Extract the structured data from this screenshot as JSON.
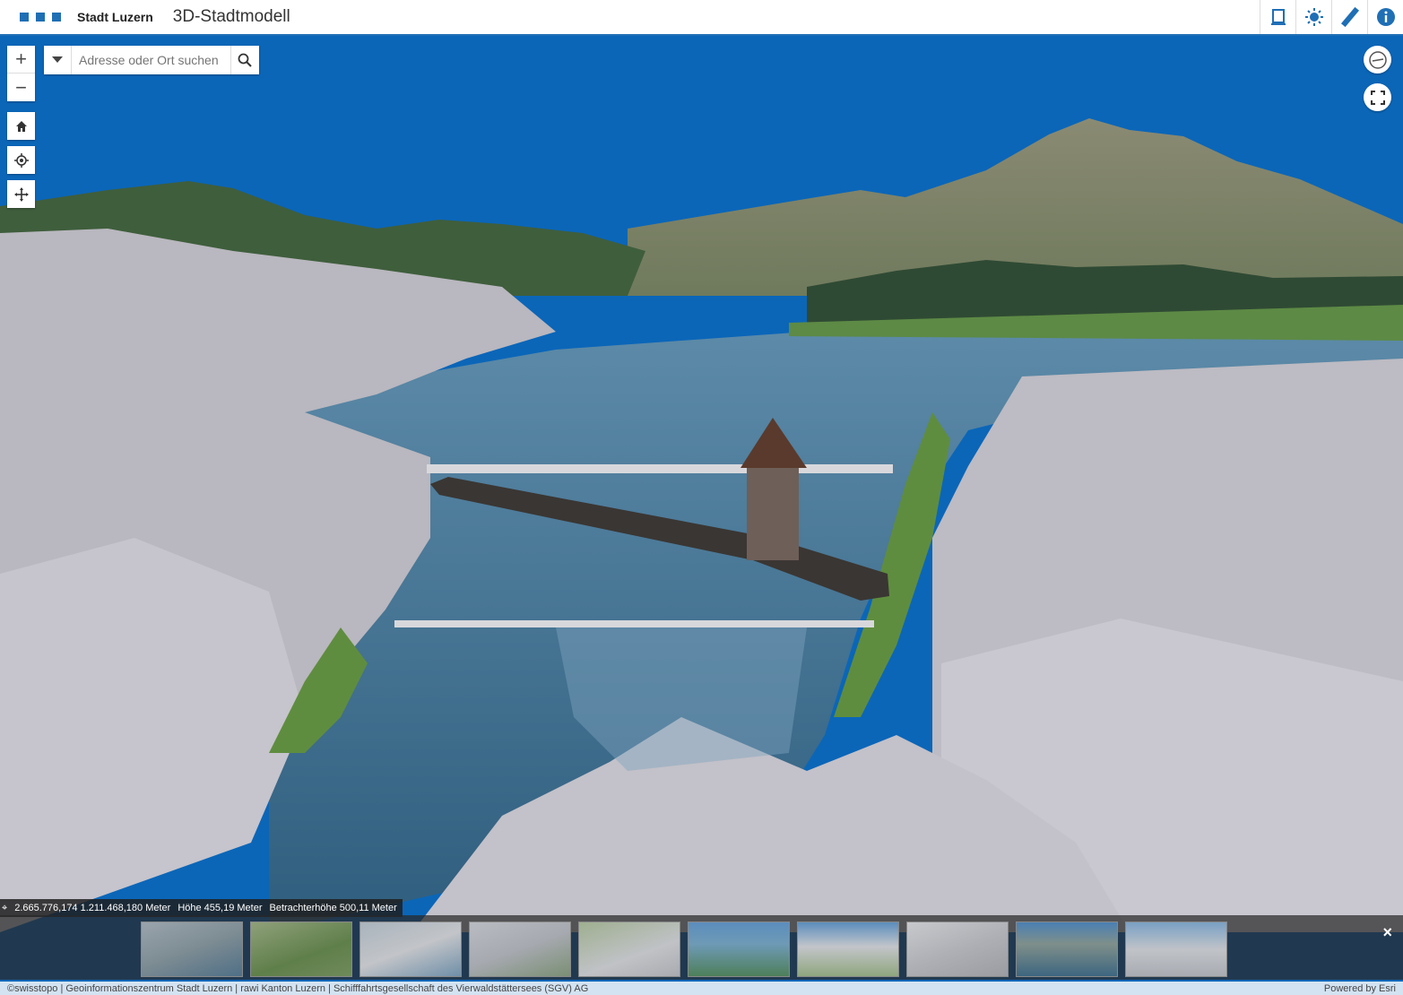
{
  "header": {
    "brand": "Stadt Luzern",
    "title": "3D-Stadtmodell",
    "tools": [
      {
        "icon": "slides-icon"
      },
      {
        "icon": "daylight-icon"
      },
      {
        "icon": "measure-icon"
      },
      {
        "icon": "info-icon"
      }
    ]
  },
  "search": {
    "placeholder": "Adresse oder Ort suchen"
  },
  "controls": {
    "zoom_in": "+",
    "zoom_out": "−"
  },
  "coordinates": {
    "position": "2.665.776,174 1.211.468,180 Meter",
    "height": "Höhe 455,19 Meter",
    "viewer_height": "Betrachterhöhe 500,11 Meter"
  },
  "slides": {
    "count": 10,
    "close_label": "×"
  },
  "attribution": {
    "sources": "©swisstopo | Geoinformationszentrum Stadt Luzern | rawi Kanton Luzern | Schifffahrtsgesellschaft des Vierwaldstättersees (SGV) AG",
    "powered": "Powered by Esri"
  },
  "colors": {
    "accent": "#1f6fb5",
    "sky": "#0b66b8",
    "water": "#3d6f93",
    "buildings": "#b9b7bf"
  }
}
